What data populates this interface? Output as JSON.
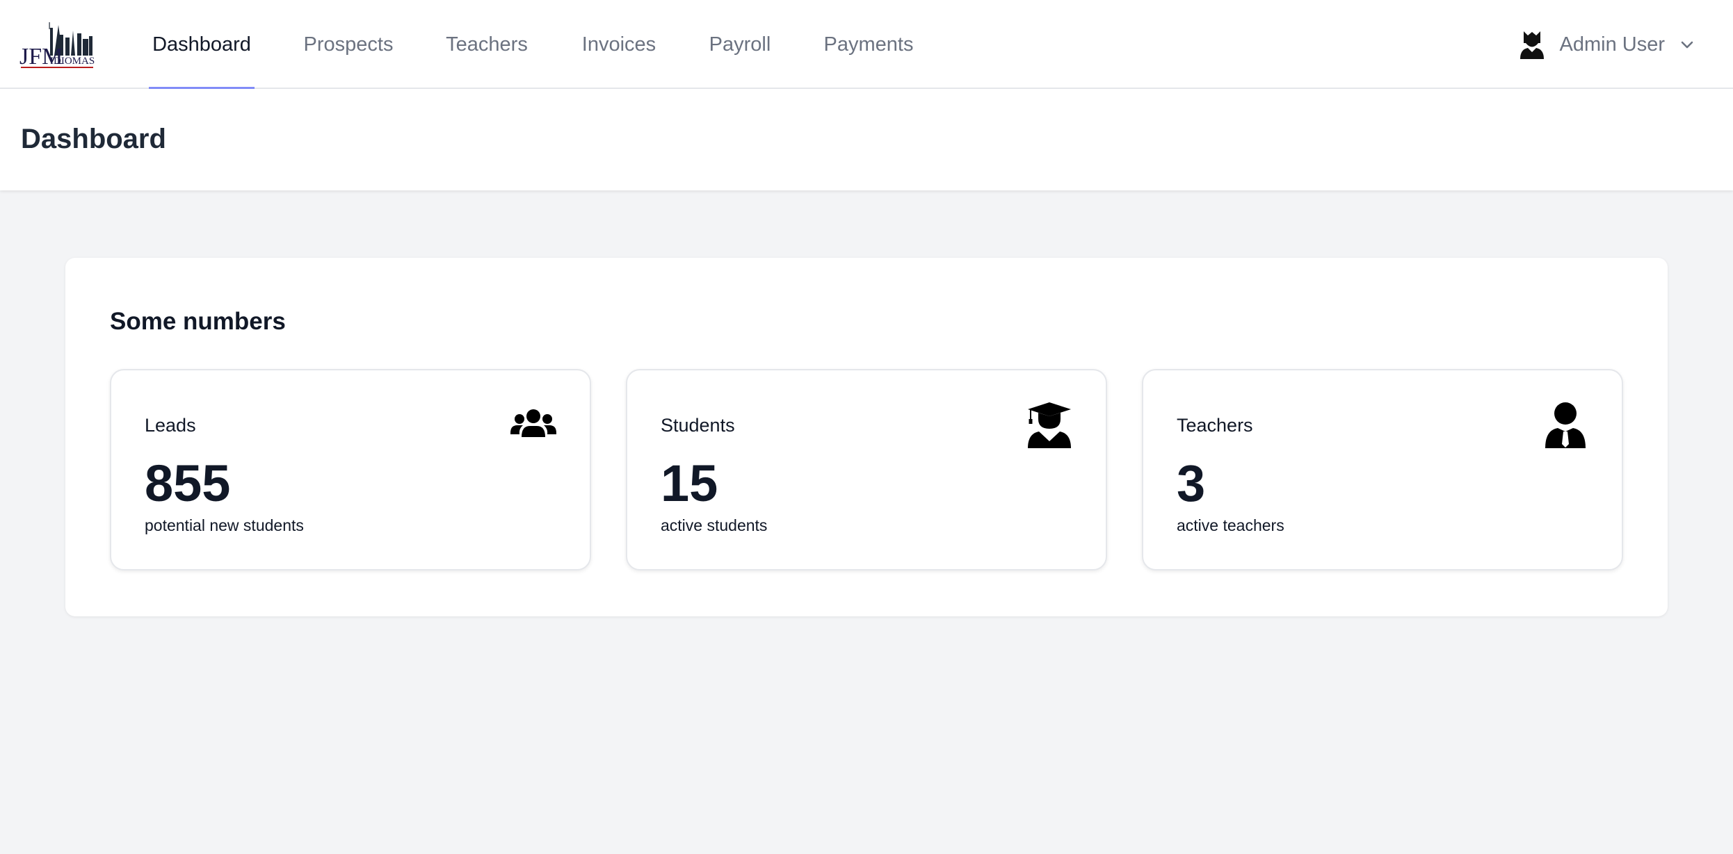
{
  "brand": {
    "logo_text": "JFM",
    "logo_subtext": "IDIOMAS"
  },
  "nav": {
    "tabs": [
      {
        "label": "Dashboard",
        "active": true
      },
      {
        "label": "Prospects",
        "active": false
      },
      {
        "label": "Teachers",
        "active": false
      },
      {
        "label": "Invoices",
        "active": false
      },
      {
        "label": "Payroll",
        "active": false
      },
      {
        "label": "Payments",
        "active": false
      }
    ],
    "active_color": "#818cf8"
  },
  "user_menu": {
    "name": "Admin User",
    "avatar_icon": "user-secret-icon",
    "dropdown_icon": "chevron-down-icon"
  },
  "page": {
    "title": "Dashboard"
  },
  "stats_panel": {
    "heading": "Some numbers",
    "cards": [
      {
        "title": "Leads",
        "value": "855",
        "caption": "potential new students",
        "icon": "users-icon"
      },
      {
        "title": "Students",
        "value": "15",
        "caption": "active students",
        "icon": "graduate-icon"
      },
      {
        "title": "Teachers",
        "value": "3",
        "caption": "active teachers",
        "icon": "user-tie-icon"
      }
    ]
  }
}
